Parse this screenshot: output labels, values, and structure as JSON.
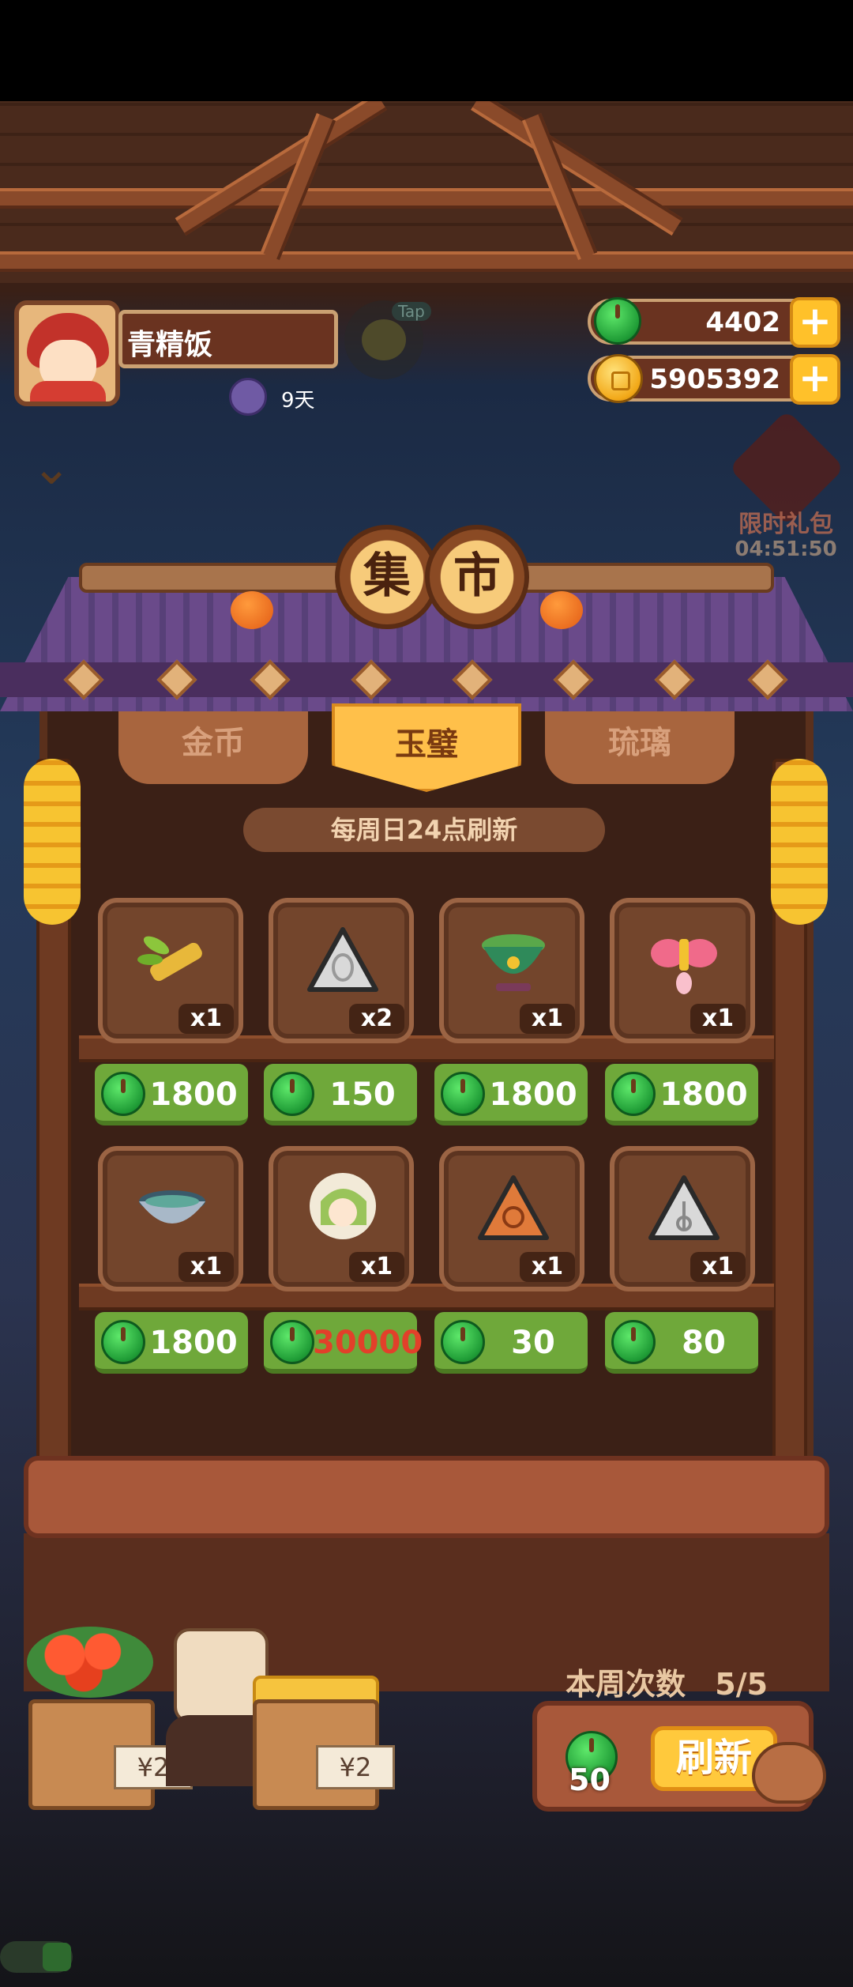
{
  "player": {
    "name": "青精饭",
    "days": "9天",
    "tap_label": "Tap"
  },
  "currency": {
    "jade": "4402",
    "gold": "5905392"
  },
  "gift": {
    "label": "限时礼包",
    "timer": "04:51:50"
  },
  "market": {
    "sign": [
      "集",
      "市"
    ],
    "tabs": [
      {
        "label": "金币",
        "active": false
      },
      {
        "label": "玉璧",
        "active": true
      },
      {
        "label": "琉璃",
        "active": false
      }
    ],
    "refresh_note": "每周日24点刷新",
    "items": [
      {
        "icon": "bamboo-shoot-icon",
        "qty": "x1",
        "price": "1800",
        "affordable": true
      },
      {
        "icon": "silver-insect-charm-icon",
        "qty": "x2",
        "price": "150",
        "affordable": true
      },
      {
        "icon": "jade-incense-burner-icon",
        "qty": "x1",
        "price": "1800",
        "affordable": true
      },
      {
        "icon": "pink-bow-ornament-icon",
        "qty": "x1",
        "price": "1800",
        "affordable": true
      },
      {
        "icon": "porcelain-bowl-icon",
        "qty": "x1",
        "price": "1800",
        "affordable": true
      },
      {
        "icon": "green-hair-character-icon",
        "qty": "x1",
        "price": "30000",
        "affordable": false
      },
      {
        "icon": "bronze-sun-charm-icon",
        "qty": "x1",
        "price": "30",
        "affordable": true
      },
      {
        "icon": "silver-tree-charm-icon",
        "qty": "x1",
        "price": "80",
        "affordable": true
      }
    ]
  },
  "refresh": {
    "week_count_label": "本周次数",
    "week_count": "5/5",
    "cost": "50",
    "button_label": "刷新"
  },
  "vendor": {
    "tag_left": "¥2",
    "tag_right": "¥2"
  },
  "colors": {
    "price_bg": "#6fa83a",
    "unaffordable_price": "#e2402a",
    "active_tab": "#ffc04a"
  }
}
